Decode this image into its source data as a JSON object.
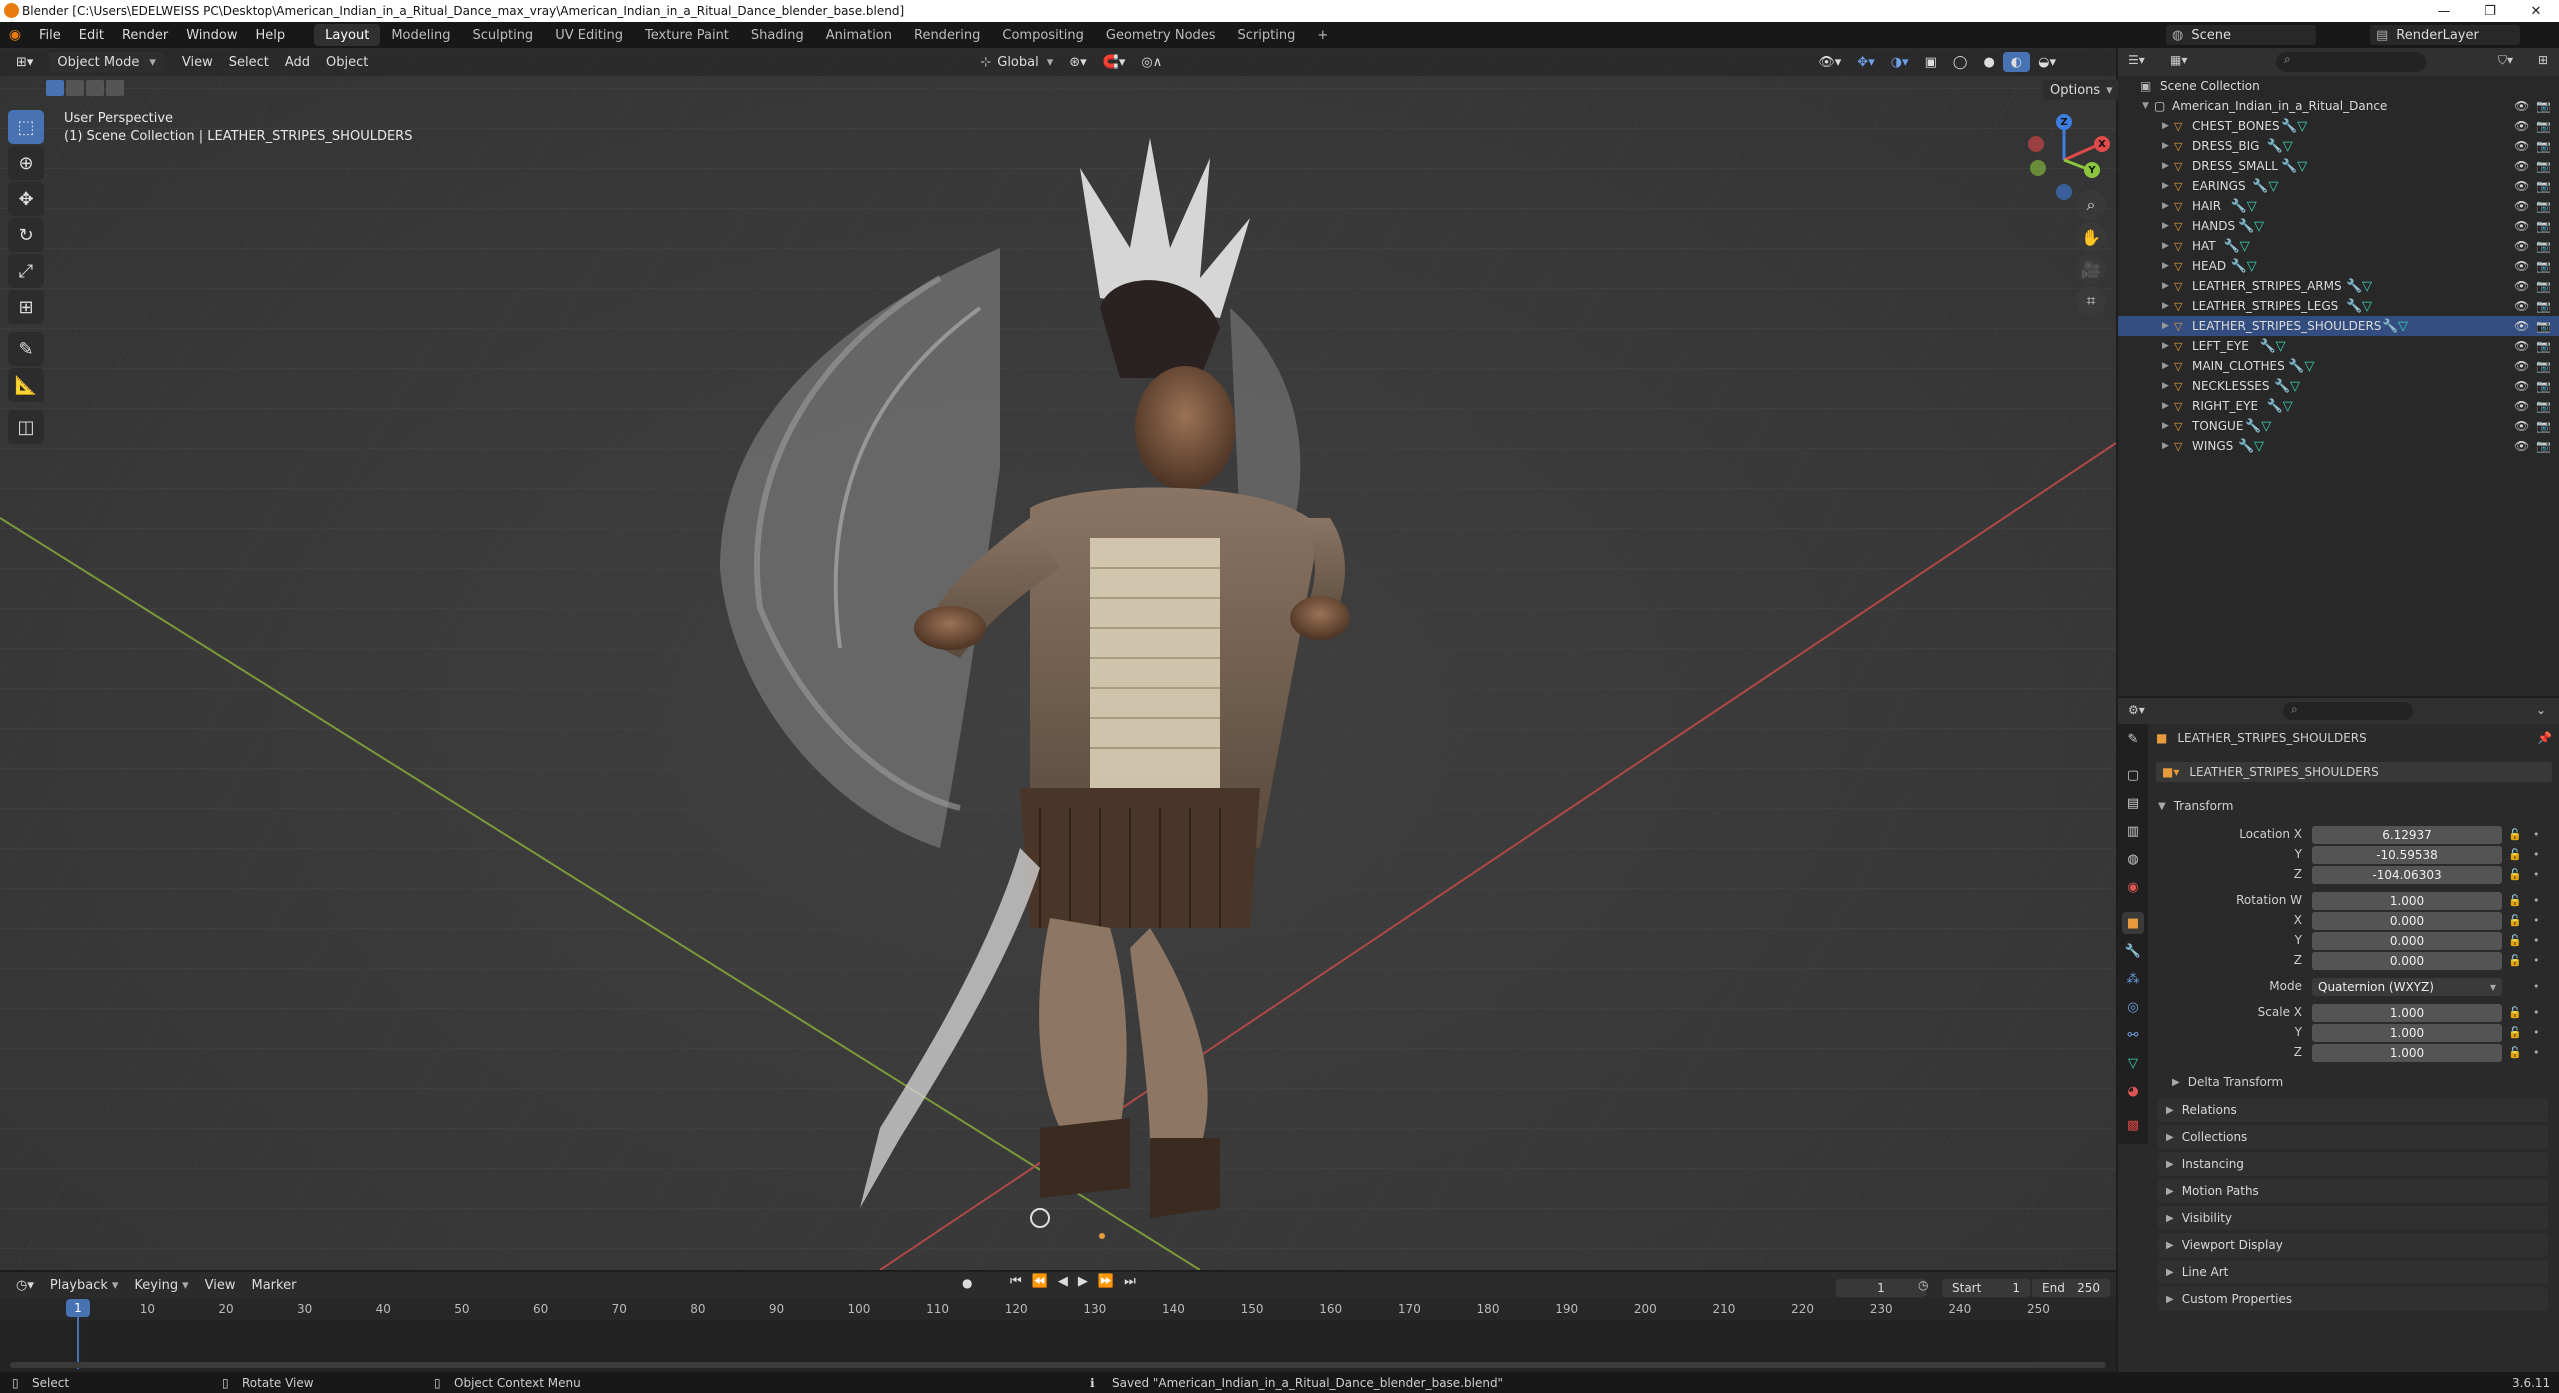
{
  "window": {
    "title": "Blender [C:\\Users\\EDELWEISS PC\\Desktop\\American_Indian_in_a_Ritual_Dance_max_vray\\American_Indian_in_a_Ritual_Dance_blender_base.blend]",
    "minimize": "—",
    "maximize": "❐",
    "close": "✕"
  },
  "menu": {
    "items": [
      "File",
      "Edit",
      "Render",
      "Window",
      "Help"
    ],
    "workspaces": [
      "Layout",
      "Modeling",
      "Sculpting",
      "UV Editing",
      "Texture Paint",
      "Shading",
      "Animation",
      "Rendering",
      "Compositing",
      "Geometry Nodes",
      "Scripting"
    ],
    "add_workspace": "+",
    "scene": "Scene",
    "render_layer": "RenderLayer"
  },
  "viewport": {
    "mode": "Object Mode",
    "menus": [
      "View",
      "Select",
      "Add",
      "Object"
    ],
    "transform_orientation": "Global",
    "options": "Options",
    "perspective": "User Perspective",
    "collection_info": "(1) Scene Collection | LEATHER_STRIPES_SHOULDERS"
  },
  "outliner": {
    "search_placeholder": "",
    "root": "Scene Collection",
    "collection": "American_Indian_in_a_Ritual_Dance",
    "objects": [
      "CHEST_BONES",
      "DRESS_BIG",
      "DRESS_SMALL",
      "EARINGS",
      "HAIR",
      "HANDS",
      "HAT",
      "HEAD",
      "LEATHER_STRIPES_ARMS",
      "LEATHER_STRIPES_LEGS",
      "LEATHER_STRIPES_SHOULDERS",
      "LEFT_EYE",
      "MAIN_CLOTHES",
      "NECKLESSES",
      "RIGHT_EYE",
      "TONGUE",
      "WINGS"
    ],
    "selected": "LEATHER_STRIPES_SHOULDERS"
  },
  "properties": {
    "object_name": "LEATHER_STRIPES_SHOULDERS",
    "datablock_name": "LEATHER_STRIPES_SHOULDERS",
    "transform_header": "Transform",
    "location": {
      "label_x": "Location X",
      "label_y": "Y",
      "label_z": "Z",
      "x": "6.12937",
      "y": "-10.59538",
      "z": "-104.06303"
    },
    "rotation": {
      "label_w": "Rotation W",
      "label_x": "X",
      "label_y": "Y",
      "label_z": "Z",
      "w": "1.000",
      "x": "0.000",
      "y": "0.000",
      "z": "0.000"
    },
    "mode": {
      "label": "Mode",
      "value": "Quaternion (WXYZ)"
    },
    "scale": {
      "label_x": "Scale X",
      "label_y": "Y",
      "label_z": "Z",
      "x": "1.000",
      "y": "1.000",
      "z": "1.000"
    },
    "delta_transform": "Delta Transform",
    "panels": [
      "Relations",
      "Collections",
      "Instancing",
      "Motion Paths",
      "Visibility",
      "Viewport Display",
      "Line Art",
      "Custom Properties"
    ]
  },
  "timeline": {
    "menus": [
      "Playback",
      "Keying",
      "View",
      "Marker"
    ],
    "current_frame": "1",
    "start_label": "Start",
    "start": "1",
    "end_label": "End",
    "end": "250",
    "ruler": [
      "1",
      "10",
      "20",
      "30",
      "40",
      "50",
      "60",
      "70",
      "80",
      "90",
      "100",
      "110",
      "120",
      "130",
      "140",
      "150",
      "160",
      "170",
      "180",
      "190",
      "200",
      "210",
      "220",
      "230",
      "240",
      "250"
    ]
  },
  "status": {
    "select": "Select",
    "rotate": "Rotate View",
    "context": "Object Context Menu",
    "saved": "Saved \"American_Indian_in_a_Ritual_Dance_blender_base.blend\"",
    "version": "3.6.11"
  },
  "gizmo": {
    "x": "X",
    "y": "Y",
    "z": "Z"
  },
  "colors": {
    "accent": "#4772b3",
    "object_icon": "#e89b3c",
    "mesh_icon": "#39d3b4",
    "x_axis": "#e04a4a",
    "y_axis": "#8cc63f",
    "z_axis": "#3e7ee0"
  }
}
